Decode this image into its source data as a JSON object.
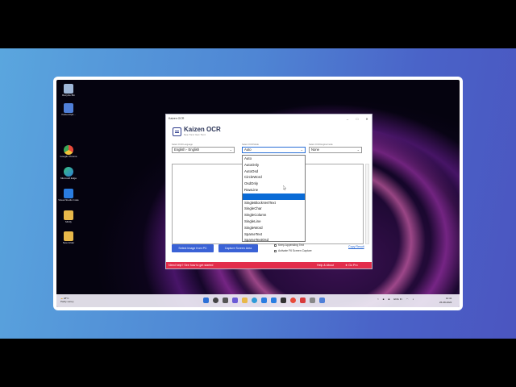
{
  "desktop": {
    "icons": [
      {
        "label": "Recycle Bin",
        "color": "#9fb7d8"
      },
      {
        "label": "KaizenOpti...",
        "color": "#4f7fd8"
      },
      {
        "label": "Google Chrome",
        "color": "#f0c23a"
      },
      {
        "label": "Microsoft Edge",
        "color": "#2f9bd8"
      },
      {
        "label": "Visual Studio Code",
        "color": "#2a7de1"
      },
      {
        "label": "Minify",
        "color": "#e8b84a"
      },
      {
        "label": "New folder",
        "color": "#e8b84a"
      }
    ]
  },
  "window": {
    "title": "Kaizen OCR",
    "brand_name": "Kaizen OCR",
    "brand_tagline": "See Text Get Text",
    "language": {
      "label": "Select OCR Language",
      "value": "English - English"
    },
    "mode": {
      "label": "Select OCR Mode",
      "value": "Auto"
    },
    "engine": {
      "label": "Select OCR Engine/mode",
      "value": "None"
    },
    "mode_options": [
      "Auto",
      "AutoOnly",
      "AutoOsd",
      "CircleWord",
      "OsdOnly",
      "RawLine",
      "",
      "SingleBlockVertText",
      "SingleChar",
      "SingleColumn",
      "SingleLine",
      "SingleWord",
      "SparseText",
      "SparseTextOsd"
    ],
    "highlighted_index": 6,
    "buttons": {
      "select_image": "Select Image from PC",
      "capture": "Capture Screen Area"
    },
    "checkboxes": {
      "keep_appending": "Keep Appending Text",
      "activate_f6": "Activate F6 Screen Capture"
    },
    "copy_result": "Copy Result",
    "footer": {
      "help": "Need help? See how to get started",
      "about": "Help & About",
      "pro": "Go Pro"
    }
  },
  "taskbar": {
    "weather_temp": "28°C",
    "weather_text": "Partly sunny",
    "lang": "ENG IN",
    "time": "12:41",
    "date": "26-08-2022"
  },
  "colors": {
    "accent": "#3a62d6",
    "footer": "#e22d4b",
    "highlight": "#0a6bd6"
  }
}
